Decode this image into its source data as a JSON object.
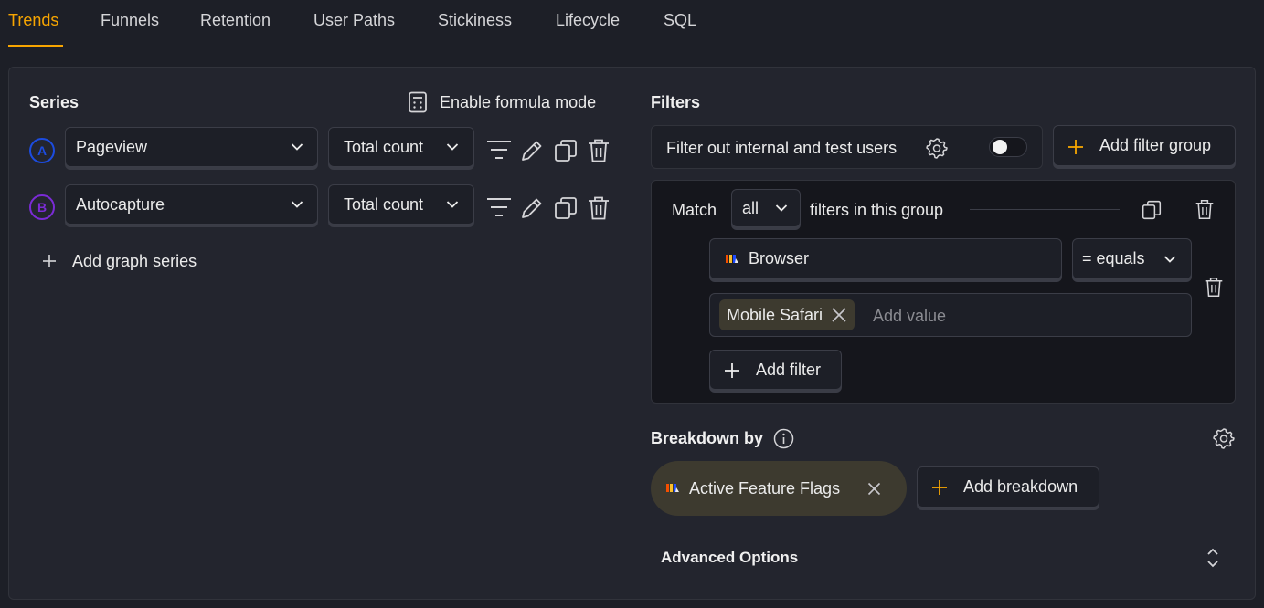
{
  "tabs": [
    {
      "label": "Trends",
      "active": true
    },
    {
      "label": "Funnels"
    },
    {
      "label": "Retention"
    },
    {
      "label": "User Paths"
    },
    {
      "label": "Stickiness"
    },
    {
      "label": "Lifecycle"
    },
    {
      "label": "SQL"
    }
  ],
  "colors": {
    "accent": "#f7a501",
    "series_a": "#1c4ce0",
    "series_b": "#7b2bd6"
  },
  "series": {
    "title": "Series",
    "formula_label": "Enable formula mode",
    "items": [
      {
        "letter": "A",
        "event": "Pageview",
        "math": "Total count"
      },
      {
        "letter": "B",
        "event": "Autocapture",
        "math": "Total count"
      }
    ],
    "add_label": "Add graph series"
  },
  "filters": {
    "title": "Filters",
    "test_users_label": "Filter out internal and test users",
    "add_group_label": "Add filter group",
    "group": {
      "match_label": "Match",
      "match_value": "all",
      "match_suffix": "filters in this group",
      "property": "Browser",
      "operator": "= equals",
      "value_chip": "Mobile Safari",
      "value_placeholder": "Add value",
      "add_filter_label": "Add filter"
    }
  },
  "breakdown": {
    "title": "Breakdown by",
    "chip": "Active Feature Flags",
    "add_label": "Add breakdown"
  },
  "advanced": {
    "label": "Advanced Options"
  }
}
